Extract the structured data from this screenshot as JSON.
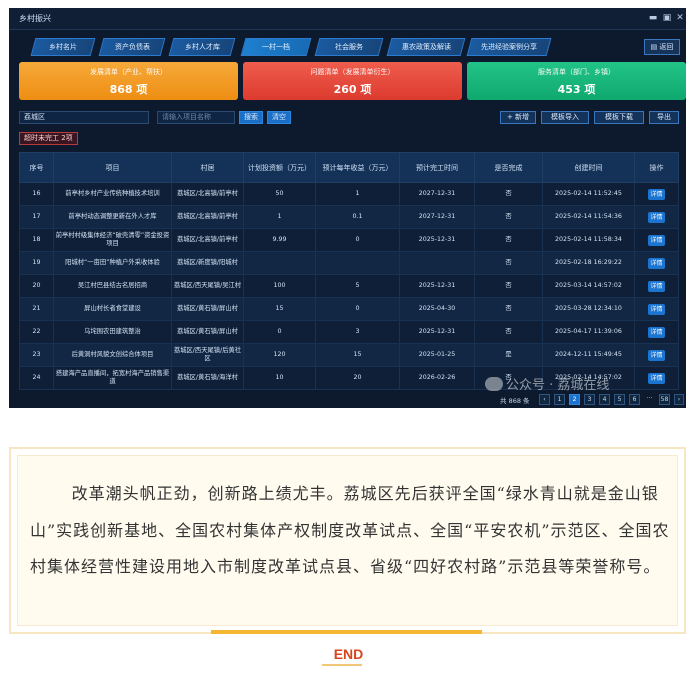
{
  "window": {
    "title": "乡村振兴",
    "controls": [
      "▬",
      "▣",
      "✕"
    ]
  },
  "tabs": [
    {
      "label": "乡村名片",
      "active": false
    },
    {
      "label": "资产负债表",
      "active": false
    },
    {
      "label": "乡村人才库",
      "active": false
    },
    {
      "label": "一村一档",
      "active": true
    },
    {
      "label": "社会服务",
      "active": false
    },
    {
      "label": "惠农政策及解读",
      "active": false
    },
    {
      "label": "先进经验案例分享",
      "active": false
    }
  ],
  "return_label": "▤ 返回",
  "cards": [
    {
      "label": "发展清单（产业、帮扶）",
      "value": "868 项",
      "color": "#f39b1c"
    },
    {
      "label": "问题清单（发展清单衍生）",
      "value": "260 项",
      "color": "#e8493b"
    },
    {
      "label": "服务清单（部门、乡镇）",
      "value": "453 项",
      "color": "#16b77c"
    }
  ],
  "toolbar": {
    "region": "荔城区",
    "search_placeholder": "请输入项目名称",
    "search_label": "搜索",
    "clear_label": "清空",
    "add_label": "+ 新增",
    "import_label": "模板导入",
    "download_label": "模板下载",
    "export_label": "导出"
  },
  "overdue_label": "超时未完工 2项",
  "table": {
    "headers": [
      "序号",
      "项目",
      "村居",
      "计划投资额（万元）",
      "预计每年收益（万元）",
      "预计完工时间",
      "是否完成",
      "创建时间",
      "操作"
    ],
    "detail_label": "详情",
    "rows": [
      [
        "16",
        "前亭村乡村产业传统种植技术培训",
        "荔城区/北高镇/前亭村",
        "50",
        "1",
        "2027-12-31",
        "否",
        "2025-02-14 11:52:45"
      ],
      [
        "17",
        "前亭村动态调整更新在外人才库",
        "荔城区/北高镇/前亭村",
        "1",
        "0.1",
        "2027-12-31",
        "否",
        "2025-02-14 11:54:36"
      ],
      [
        "18",
        "前亭村村级集体经济“破壳清零”资金投资项目",
        "荔城区/北高镇/前亭村",
        "9.99",
        "0",
        "2025-12-31",
        "否",
        "2025-02-14 11:58:34"
      ],
      [
        "19",
        "阳城村“一亩田”种植户外采收体验",
        "荔城区/新度镇/阳城村",
        "",
        "",
        "",
        "否",
        "2025-02-18 16:29:22"
      ],
      [
        "20",
        "吴江村巴县结古名居招商",
        "荔城区/西天尾镇/吴江村",
        "100",
        "5",
        "2025-12-31",
        "否",
        "2025-03-14 14:57:02"
      ],
      [
        "21",
        "屏山村长者食堂建设",
        "荔城区/黄石镇/屏山村",
        "15",
        "0",
        "2025-04-30",
        "否",
        "2025-03-28 12:34:10"
      ],
      [
        "22",
        "乌垞围农田建筑整治",
        "荔城区/黄石镇/屏山村",
        "0",
        "3",
        "2025-12-31",
        "否",
        "2025-04-17 11:39:06"
      ],
      [
        "23",
        "后黄洞村风貌文创综合体项目",
        "荔城区/西天尾镇/后黄社区",
        "120",
        "15",
        "2025-01-25",
        "是",
        "2024-12-11 15:49:45"
      ],
      [
        "24",
        "搭建海产品直播间，拓宽村海产品销售渠道",
        "荔城区/黄石镇/海洋村",
        "10",
        "20",
        "2026-02-26",
        "否",
        "2025-02-14 14:57:02"
      ]
    ]
  },
  "pager": {
    "total": "共 868 条",
    "prev": "‹",
    "pages": [
      "1",
      "2",
      "3",
      "4",
      "5",
      "6"
    ],
    "active_page": "2",
    "ellipsis": "···",
    "last": "58",
    "next": "›"
  },
  "watermark": "公众号 · 荔城在线",
  "paragraph": "改革潮头帆正劲，创新路上绩尤丰。荔城区先后获评全国“绿水青山就是金山银山”实践创新基地、全国农村集体产权制度改革试点、全国“平安农机”示范区、全国农村集体经营性建设用地入市制度改革试点县、省级“四好农村路”示范县等荣誉称号。",
  "end_label": "END"
}
